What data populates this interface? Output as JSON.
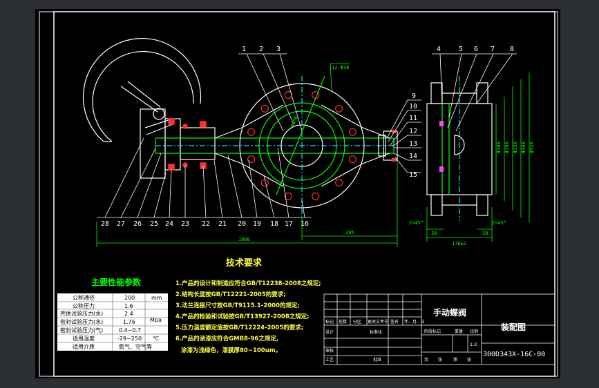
{
  "colors": {
    "bg": "#2b2e33",
    "paper": "#000000",
    "line": "#ffffff",
    "green": "#00ff00",
    "cyan": "#00e5e5",
    "red": "#ff3030",
    "yellow": "#ffff40",
    "magenta": "#ff40ff"
  },
  "balloons_top_left": [
    "1",
    "2",
    "3"
  ],
  "balloons_right_top": [
    "4",
    "5",
    "6",
    "7",
    "8"
  ],
  "balloons_right_side": [
    "9",
    "10",
    "11",
    "12",
    "13",
    "14",
    "15"
  ],
  "balloons_bottom": [
    "28",
    "27",
    "26",
    "25",
    "24",
    "23",
    "22",
    "21",
    "20",
    "19",
    "18",
    "17",
    "16"
  ],
  "dims": {
    "bolt_pattern": "12-Φ38",
    "pcd": "Φ460",
    "overall_length": "1000",
    "right_length": "295",
    "face_to_face": "178±2",
    "side_a": "30",
    "side_b": "30",
    "chamfer_left": "2×45°",
    "chamfer_right": "2×45°",
    "v1": "Φ400",
    "v2": "Φ300",
    "v3": "Φ350",
    "v4": "Φ460",
    "v5": "Φ520"
  },
  "tech_title": "技术要求",
  "tech_requirements": [
    "1.产品的设计和制造应符合GB/T12238-2008之规定;",
    "2.结构长度按GB/T12221-2005的要求;",
    "3.法兰连接尺寸按GB/T9115.1-2000的规定;",
    "4.产品的检验和试验按GB/T13927-2008之规定;",
    "5.压力温度额定值按GB/T12224-2005的要求;",
    "6.产品的涂漆应符合GMB8-96之规定,",
    "涂漆为浅绿色，漆膜厚80~100um。"
  ],
  "params": {
    "title": "主要性能参数",
    "rows": [
      {
        "name": "公称通径",
        "value": "200",
        "unit": "mm"
      },
      {
        "name": "公称压力",
        "value": "1.6",
        "unit": ""
      },
      {
        "name": "壳体试验压力(水)",
        "value": "2.4",
        "unit": "Mpa"
      },
      {
        "name": "密封试验压力(水)",
        "value": "1.76",
        "unit": ""
      },
      {
        "name": "密封试验压力(气)",
        "value": "0.4~0.7",
        "unit": ""
      },
      {
        "name": "适用温度",
        "value": "-29~250",
        "unit": "℃"
      },
      {
        "name": "适用介质",
        "value": "氮气、空气等",
        "unit": ""
      }
    ]
  },
  "title_block": {
    "product": "手动蝶阀",
    "drawing_name": "装配图",
    "code": "300D343X-16C-00",
    "scale": "1:2",
    "headers": [
      "标记",
      "处数",
      "分区",
      "更改文件号",
      "签名",
      "年、月、日"
    ],
    "row_design": [
      "设计",
      "",
      "标准化"
    ],
    "row_review": "审核",
    "row_process": "工艺",
    "approve": "批准",
    "stage_labels": [
      "阶段标记",
      "重量",
      "比例"
    ],
    "sheet_labels": [
      "共",
      "张",
      "第",
      "张"
    ]
  }
}
